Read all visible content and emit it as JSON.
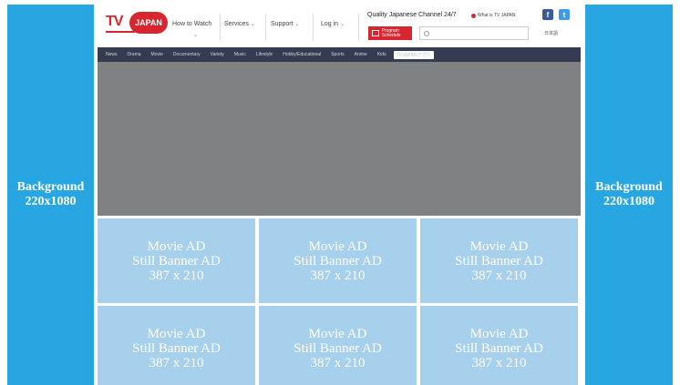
{
  "background_panels": {
    "left": {
      "line1": "Background",
      "line2": "220x1080"
    },
    "right": {
      "line1": "Background",
      "line2": "220x1080"
    }
  },
  "header": {
    "logo": {
      "prefix": "TV",
      "circle": "JAPAN"
    },
    "nav": [
      {
        "label": "How to Watch"
      },
      {
        "label": "Services"
      },
      {
        "label": "Support"
      },
      {
        "label": "Log in"
      }
    ],
    "tagline": "Quality Japanese Channel 24/7",
    "what_link": "What is TV JAPAN",
    "program_button": "Program Schedule",
    "search": {
      "placeholder": ""
    },
    "social": {
      "facebook": "f",
      "twitter": "t"
    },
    "language": "日本語"
  },
  "category_nav": {
    "items": [
      "News",
      "Drama",
      "Movie",
      "Documentary",
      "Variety",
      "Music",
      "Lifestyle",
      "Hobby/Educational",
      "Sports",
      "Anime",
      "Kids"
    ],
    "badge": "TVJAPANアプリ"
  },
  "ads": [
    {
      "line1": "Movie AD",
      "line2": "Still Banner AD",
      "line3": "387 x 210"
    },
    {
      "line1": "Movie AD",
      "line2": "Still Banner AD",
      "line3": "387 x 210"
    },
    {
      "line1": "Movie AD",
      "line2": "Still Banner AD",
      "line3": "387 x 210"
    },
    {
      "line1": "Movie AD",
      "line2": "Still Banner AD",
      "line3": "387 x 210"
    },
    {
      "line1": "Movie AD",
      "line2": "Still Banner AD",
      "line3": "387 x 210"
    },
    {
      "line1": "Movie AD",
      "line2": "Still Banner AD",
      "line3": "387 x 210"
    }
  ],
  "colors": {
    "side_background": "#27a6e1",
    "brand_red": "#d7262f",
    "category_bar": "#353b51",
    "hero_placeholder": "#808183",
    "ad_placeholder": "#a6d0ec"
  }
}
